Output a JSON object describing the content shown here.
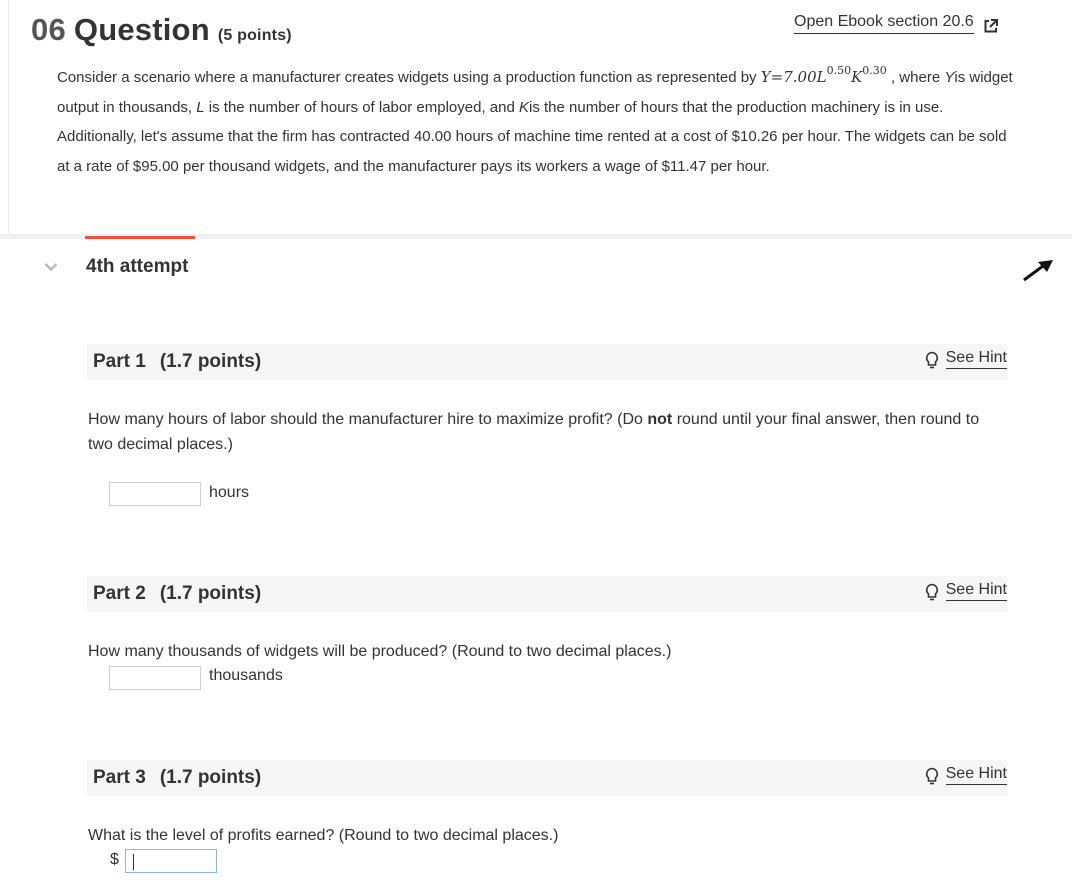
{
  "question": {
    "number": "06",
    "title": "Question",
    "points": "(5 points)",
    "ebook_link": "Open Ebook section 20.6",
    "stem": {
      "intro": "Consider a scenario where a manufacturer creates widgets using a production function as represented by",
      "formula_y": "Y",
      "formula_eq": "=7.00",
      "formula_L": "L",
      "exp_L": "0.50",
      "formula_K": "K",
      "exp_K": "0.30",
      "after_formula": ", where",
      "y_var": "Y",
      "y_desc": "is widget output in thousands,",
      "l_var": "L",
      "l_desc": "is the number of hours of labor employed, and",
      "k_var": "K",
      "k_desc": "is the number of hours that the production machinery is in use. Additionally, let's assume that the firm has contracted",
      "machine_hours": "40.00",
      "rent_text": "hours of machine time rented at a cost of",
      "rent_cost": "$10.26",
      "per_hour_1": "per hour. The widgets can be sold at a rate of",
      "price": "$95.00",
      "per_thousand": "per thousand widgets, and the manufacturer pays its workers a wage of",
      "wage": "$11.47",
      "per_hour_2": "per hour."
    }
  },
  "attempt": {
    "label": "4th attempt"
  },
  "parts": [
    {
      "label": "Part 1",
      "points": "(1.7 points)",
      "hint": "See Hint",
      "text_before": "How many hours of labor should the manufacturer hire to maximize profit? (Do",
      "text_bold": "not",
      "text_after": "round until your final answer, then round to two decimal places.)",
      "answer_value": "",
      "unit": "hours"
    },
    {
      "label": "Part 2",
      "points": "(1.7 points)",
      "hint": "See Hint",
      "text": "How many thousands of widgets will be produced? (Round to two decimal places.)",
      "answer_value": "",
      "unit": "thousands"
    },
    {
      "label": "Part 3",
      "points": "(1.7 points)",
      "hint": "See Hint",
      "text": "What is the level of profits earned? (Round to two decimal places.)",
      "prefix": "$",
      "answer_value": ""
    }
  ],
  "colors": {
    "accent": "#e8553c",
    "text": "#333333",
    "header_bg": "#f6f6f6"
  }
}
